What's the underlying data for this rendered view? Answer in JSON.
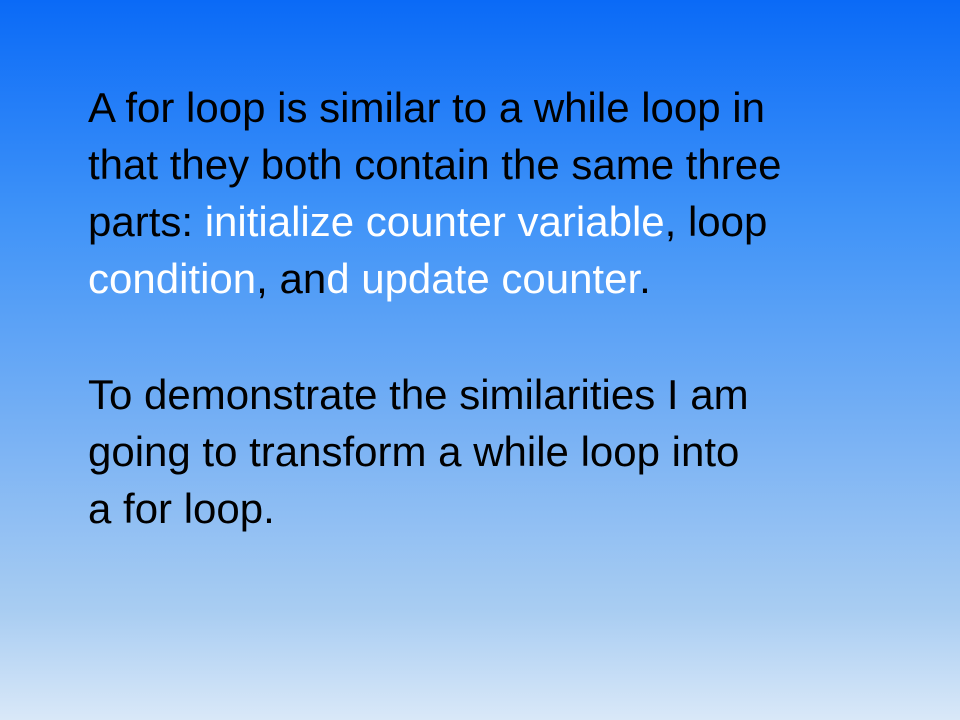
{
  "slide": {
    "paragraph1": {
      "line1": "A for loop is similar to a while loop in",
      "line2": "that they both contain the same three",
      "line3_a": "parts: ",
      "line3_b": "initialize counter variable",
      "line3_c": ", loop",
      "line4_a": "condition",
      "line4_b": ", ",
      "line4_c": "an",
      "line4_d": "d ",
      "line4_e": "update counter",
      "line4_f": "."
    },
    "paragraph2": {
      "line1": "To demonstrate the similarities I am",
      "line2": "going to transform a while loop into",
      "line3": "a for loop."
    }
  },
  "colors": {
    "background_top": "#0a6af7",
    "background_bottom": "#d9e8f8",
    "text": "#000000",
    "highlight": "#ffffff"
  }
}
